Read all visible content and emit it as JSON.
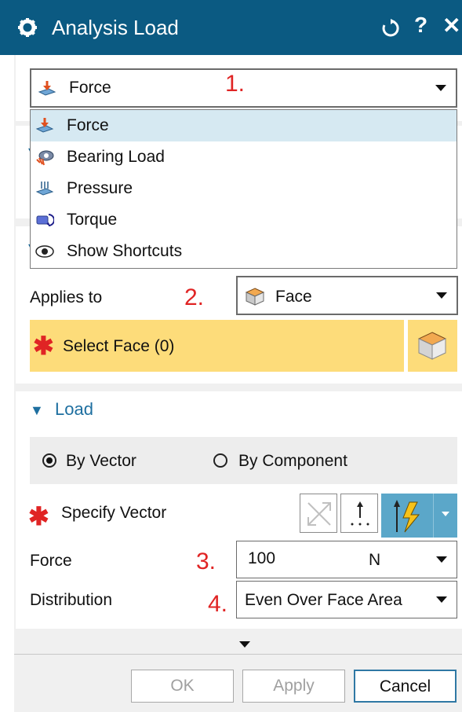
{
  "title": "Analysis Load",
  "title_icons": [
    "gear-icon",
    "reset-icon",
    "help-icon",
    "close-icon"
  ],
  "help_label": "?",
  "close_label": "✕",
  "type_combo": {
    "value": "Force",
    "icon": "force-icon"
  },
  "annotations": {
    "a1": "1.",
    "a2": "2.",
    "a3": "3.",
    "a4": "4."
  },
  "dropdown": {
    "items": [
      {
        "label": "Force",
        "icon": "force-icon"
      },
      {
        "label": "Bearing Load",
        "icon": "bearing-load-icon"
      },
      {
        "label": "Pressure",
        "icon": "pressure-icon"
      },
      {
        "label": "Torque",
        "icon": "torque-icon"
      },
      {
        "label": "Show Shortcuts",
        "icon": "eye-icon"
      }
    ]
  },
  "applies_to": {
    "label": "Applies to",
    "value": "Face"
  },
  "select_face": {
    "label": "Select Face (0)"
  },
  "load_section": {
    "title": "Load",
    "radio_vector": "By Vector",
    "radio_component": "By Component",
    "specify_vector": "Specify Vector",
    "force_label": "Force",
    "force_value": "100",
    "force_unit": "N",
    "distribution_label": "Distribution",
    "distribution_value": "Even Over Face Area"
  },
  "footer": {
    "ok": "OK",
    "apply": "Apply",
    "cancel": "Cancel"
  },
  "colors": {
    "titlebar": "#0b5a82",
    "selection": "#fddc7a",
    "accent": "#1e6fa0",
    "required": "#e02424",
    "annotation": "#e02424"
  }
}
